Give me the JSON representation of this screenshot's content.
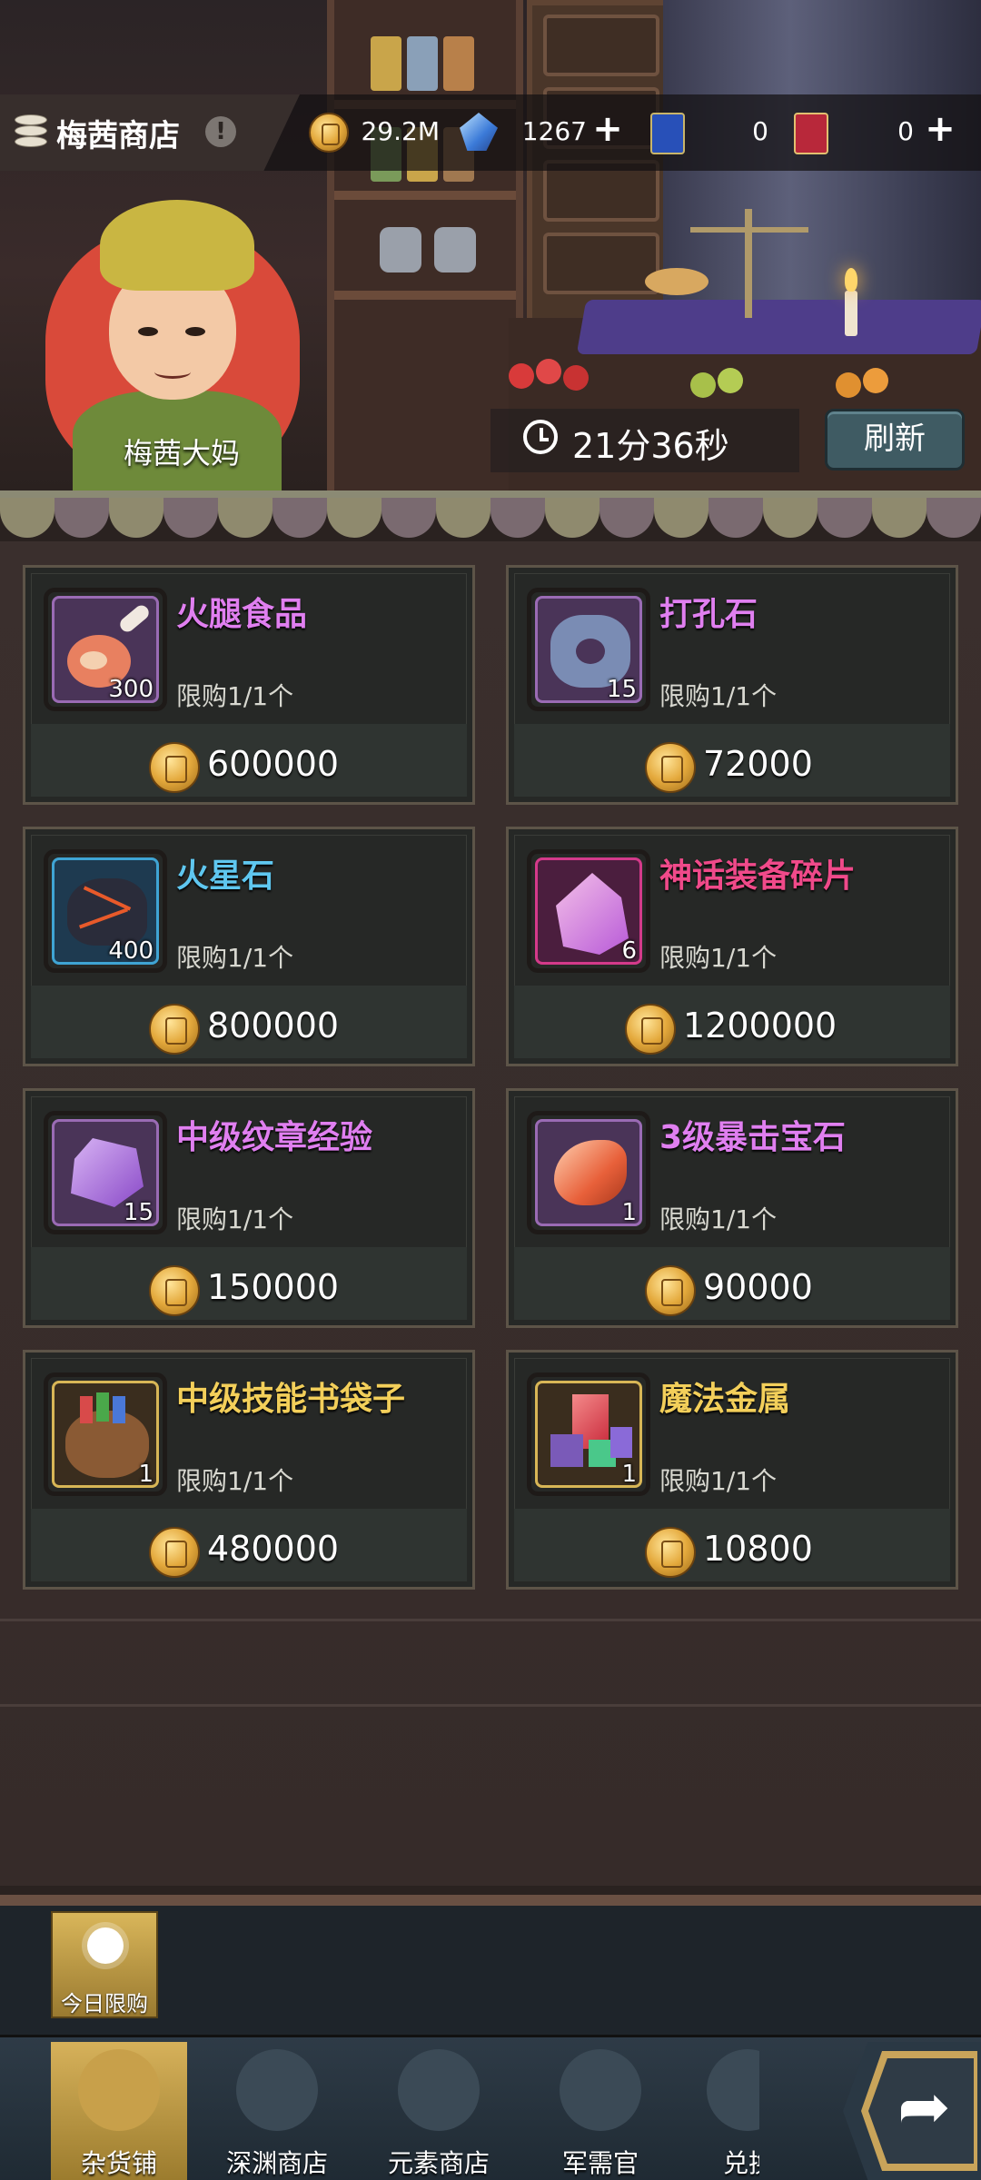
{
  "header": {
    "shop_title": "梅茜商店",
    "info_symbol": "!",
    "currencies": [
      {
        "icon": "gold-coin-icon",
        "value": "29.2M",
        "has_plus": false
      },
      {
        "icon": "blue-crystal-icon",
        "value": "1267",
        "has_plus": true
      },
      {
        "icon": "blue-ticket-icon",
        "value": "0",
        "has_plus": false
      },
      {
        "icon": "gold-ticket-icon",
        "value": "0",
        "has_plus": true
      }
    ],
    "plus_symbol": "+"
  },
  "scene": {
    "character_name": "梅茜大妈",
    "timer": "21分36秒",
    "refresh_label": "刷新"
  },
  "items": [
    {
      "name": "火腿食品",
      "qty": "300",
      "limit": "限购1/1个",
      "price": "600000",
      "name_color": "#e07ff0",
      "frame": "purple",
      "icon": "ham-icon"
    },
    {
      "name": "打孔石",
      "qty": "15",
      "limit": "限购1/1个",
      "price": "72000",
      "name_color": "#e07ff0",
      "frame": "purple",
      "icon": "punch-stone-icon"
    },
    {
      "name": "火星石",
      "qty": "400",
      "limit": "限购1/1个",
      "price": "800000",
      "name_color": "#5fc7f0",
      "frame": "blue",
      "icon": "mars-stone-icon"
    },
    {
      "name": "神话装备碎片",
      "qty": "6",
      "limit": "限购1/1个",
      "price": "1200000",
      "name_color": "#f04a8a",
      "frame": "pink",
      "icon": "crystal-shard-icon"
    },
    {
      "name": "中级纹章经验",
      "qty": "15",
      "limit": "限购1/1个",
      "price": "150000",
      "name_color": "#e07ff0",
      "frame": "purple",
      "icon": "purple-gem-icon"
    },
    {
      "name": "3级暴击宝石",
      "qty": "1",
      "limit": "限购1/1个",
      "price": "90000",
      "name_color": "#e07ff0",
      "frame": "purple",
      "icon": "crit-gem-icon"
    },
    {
      "name": "中级技能书袋子",
      "qty": "1",
      "limit": "限购1/1个",
      "price": "480000",
      "name_color": "#f3cf5a",
      "frame": "gold",
      "icon": "skill-book-bag-icon"
    },
    {
      "name": "魔法金属",
      "qty": "1",
      "limit": "限购1/1个",
      "price": "10800",
      "name_color": "#f3cf5a",
      "frame": "gold",
      "icon": "magic-metal-icon"
    }
  ],
  "subtab": {
    "daily_label": "今日限购"
  },
  "nav": [
    {
      "label": "杂货铺",
      "active": true,
      "icon": "coins-icon"
    },
    {
      "label": "深渊商店",
      "active": false,
      "icon": "chest-icon"
    },
    {
      "label": "元素商店",
      "active": false,
      "icon": "star-emblem-icon"
    },
    {
      "label": "军需官",
      "active": false,
      "icon": "helmet-icon"
    },
    {
      "label": "兑换",
      "active": false,
      "icon": "exchange-icon"
    }
  ]
}
